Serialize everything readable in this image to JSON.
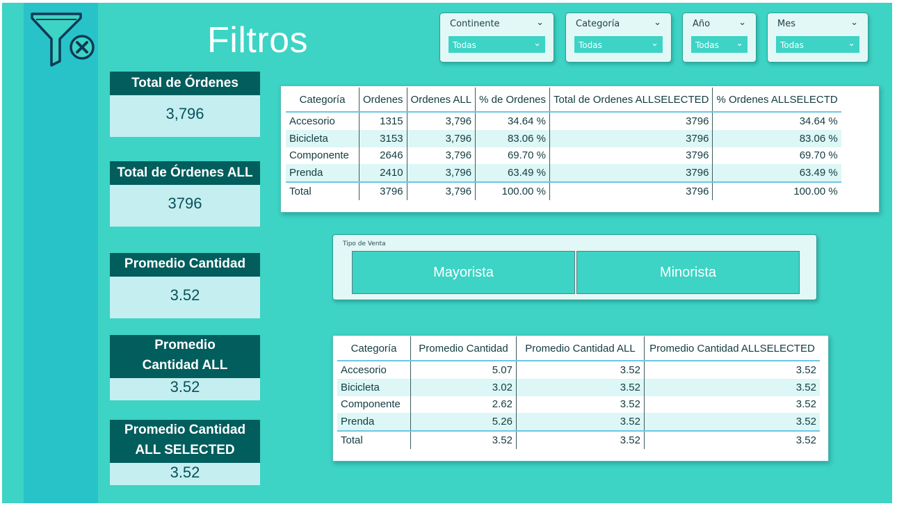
{
  "header": {
    "title": "Filtros",
    "logo_icon": "filter-clear-icon"
  },
  "slicers": [
    {
      "title": "Continente",
      "value": "Todas"
    },
    {
      "title": "Categoría",
      "value": "Todas"
    },
    {
      "title": "Año",
      "value": "Todas"
    },
    {
      "title": "Mes",
      "value": "Todas"
    }
  ],
  "kpis": [
    {
      "label": "Total de Órdenes",
      "value": "3,796"
    },
    {
      "label": "Total de Órdenes ALL",
      "value": "3796"
    },
    {
      "label": "Promedio Cantidad",
      "value": "3.52"
    },
    {
      "label": "Promedio Cantidad ALL",
      "value": "3.52"
    },
    {
      "label": "Promedio Cantidad ALL SELECTED",
      "value": "3.52"
    }
  ],
  "orders_table": {
    "headers": [
      "Categoría",
      "Ordenes",
      "Ordenes ALL",
      "% de Ordenes",
      "Total de Ordenes ALLSELECTED",
      "% Ordenes ALLSELECTD"
    ],
    "rows": [
      [
        "Accesorio",
        "1315",
        "3,796",
        "34.64 %",
        "3796",
        "34.64 %"
      ],
      [
        "Bicicleta",
        "3153",
        "3,796",
        "83.06 %",
        "3796",
        "83.06 %"
      ],
      [
        "Componente",
        "2646",
        "3,796",
        "69.70 %",
        "3796",
        "69.70 %"
      ],
      [
        "Prenda",
        "2410",
        "3,796",
        "63.49 %",
        "3796",
        "63.49 %"
      ],
      [
        "Total",
        "3796",
        "3,796",
        "100.00 %",
        "3796",
        "100.00 %"
      ]
    ]
  },
  "tipo_venta": {
    "label": "Tipo de Venta",
    "options": [
      "Mayorista",
      "Minorista"
    ]
  },
  "avg_table": {
    "headers": [
      "Categoría",
      "Promedio Cantidad",
      "Promedio Cantidad ALL",
      "Promedio Cantidad ALLSELECTED"
    ],
    "rows": [
      [
        "Accesorio",
        "5.07",
        "3.52",
        "3.52"
      ],
      [
        "Bicicleta",
        "3.02",
        "3.52",
        "3.52"
      ],
      [
        "Componente",
        "2.62",
        "3.52",
        "3.52"
      ],
      [
        "Prenda",
        "5.26",
        "3.52",
        "3.52"
      ],
      [
        "Total",
        "3.52",
        "3.52",
        "3.52"
      ]
    ]
  },
  "colors": {
    "background": "#3dd3c5",
    "strip": "#28c3c9",
    "kpi_header": "#025d5d",
    "kpi_body": "#c5eef0"
  }
}
